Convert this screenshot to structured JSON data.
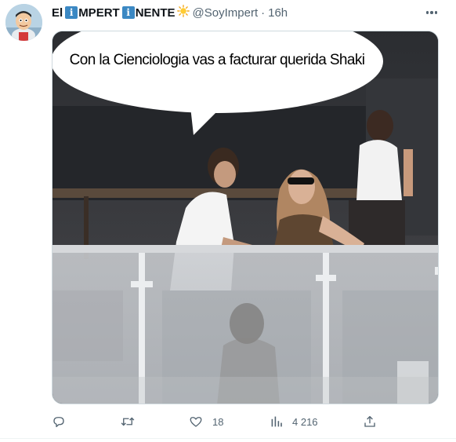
{
  "tweet": {
    "author_name_prefix": "El",
    "info_glyph": "i",
    "author_name_mid": "MPERT",
    "author_name_end": "NENTE",
    "sun_emoji": "sun-emoji",
    "handle": "@SoyImpert",
    "separator": "·",
    "time": "16h",
    "media_caption": "Con la Cienciologia vas a facturar querida Shaki"
  },
  "actions": {
    "reply": {
      "icon": "reply-icon"
    },
    "retweet": {
      "icon": "retweet-icon"
    },
    "like": {
      "icon": "heart-icon",
      "count": "18"
    },
    "views": {
      "icon": "analytics-icon",
      "count": "4 216"
    },
    "share": {
      "icon": "share-icon"
    }
  },
  "colors": {
    "text_primary": "#0f1419",
    "text_secondary": "#536471",
    "info_badge": "#3b88c3",
    "border": "#cfd9de"
  }
}
